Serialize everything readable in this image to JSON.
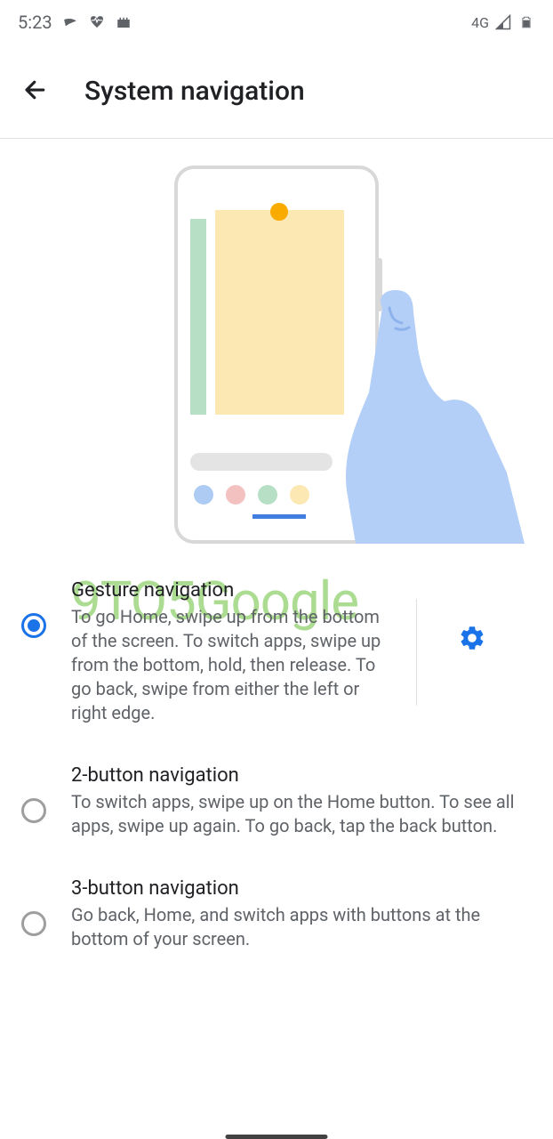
{
  "status": {
    "time": "5:23",
    "network": "4G"
  },
  "header": {
    "title": "System navigation"
  },
  "watermark": "9TO5Google",
  "options": [
    {
      "title": "Gesture navigation",
      "description": "To go Home, swipe up from the bottom of the screen. To switch apps, swipe up from the bottom, hold, then release. To go back, swipe from either the left or right edge.",
      "selected": true,
      "has_settings": true
    },
    {
      "title": "2-button navigation",
      "description": "To switch apps, swipe up on the Home button. To see all apps, swipe up again. To go back, tap the back button.",
      "selected": false,
      "has_settings": false
    },
    {
      "title": "3-button navigation",
      "description": "Go back, Home, and switch apps with buttons at the bottom of your screen.",
      "selected": false,
      "has_settings": false
    }
  ]
}
